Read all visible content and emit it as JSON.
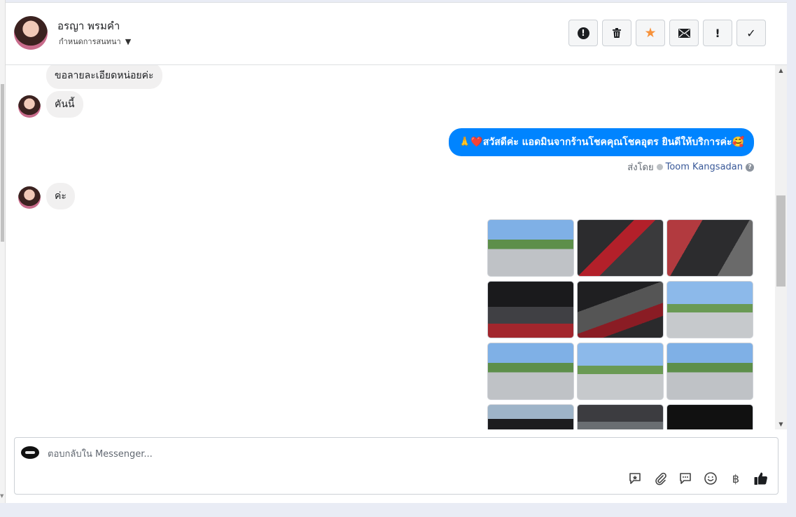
{
  "header": {
    "contact_name": "อรญา พรมคำ",
    "assign_label": "กำหนดการสนทนา"
  },
  "actions": [
    {
      "name": "report-spam-button",
      "icon": "exclamation-circle-icon"
    },
    {
      "name": "delete-button",
      "icon": "trash-icon"
    },
    {
      "name": "star-button",
      "icon": "star-icon"
    },
    {
      "name": "mark-unread-button",
      "icon": "envelope-icon"
    },
    {
      "name": "follow-up-button",
      "icon": "exclamation-icon"
    },
    {
      "name": "mark-done-button",
      "icon": "check-icon"
    }
  ],
  "messages": {
    "m1": "ขอลายละเอียดหน่อยค่ะ",
    "m2": "คันนี้",
    "m3_out": "🙏❤️สวัสดีค่ะ แอดมินจากร้านโชคคุณโชคอุตร ยินดีให้บริการค่ะ🥰",
    "sent_by_label": "ส่งโดย",
    "sent_by_agent": "Toom Kangsadan",
    "m4": "ค่ะ"
  },
  "gallery": {
    "photo_count": 12
  },
  "composer": {
    "placeholder": "ตอบกลับใน Messenger...",
    "currency_symbol": "฿"
  },
  "colors": {
    "brand_blue": "#0084ff",
    "star_orange": "#f7923b",
    "incoming_bubble": "#f1f0f0"
  }
}
